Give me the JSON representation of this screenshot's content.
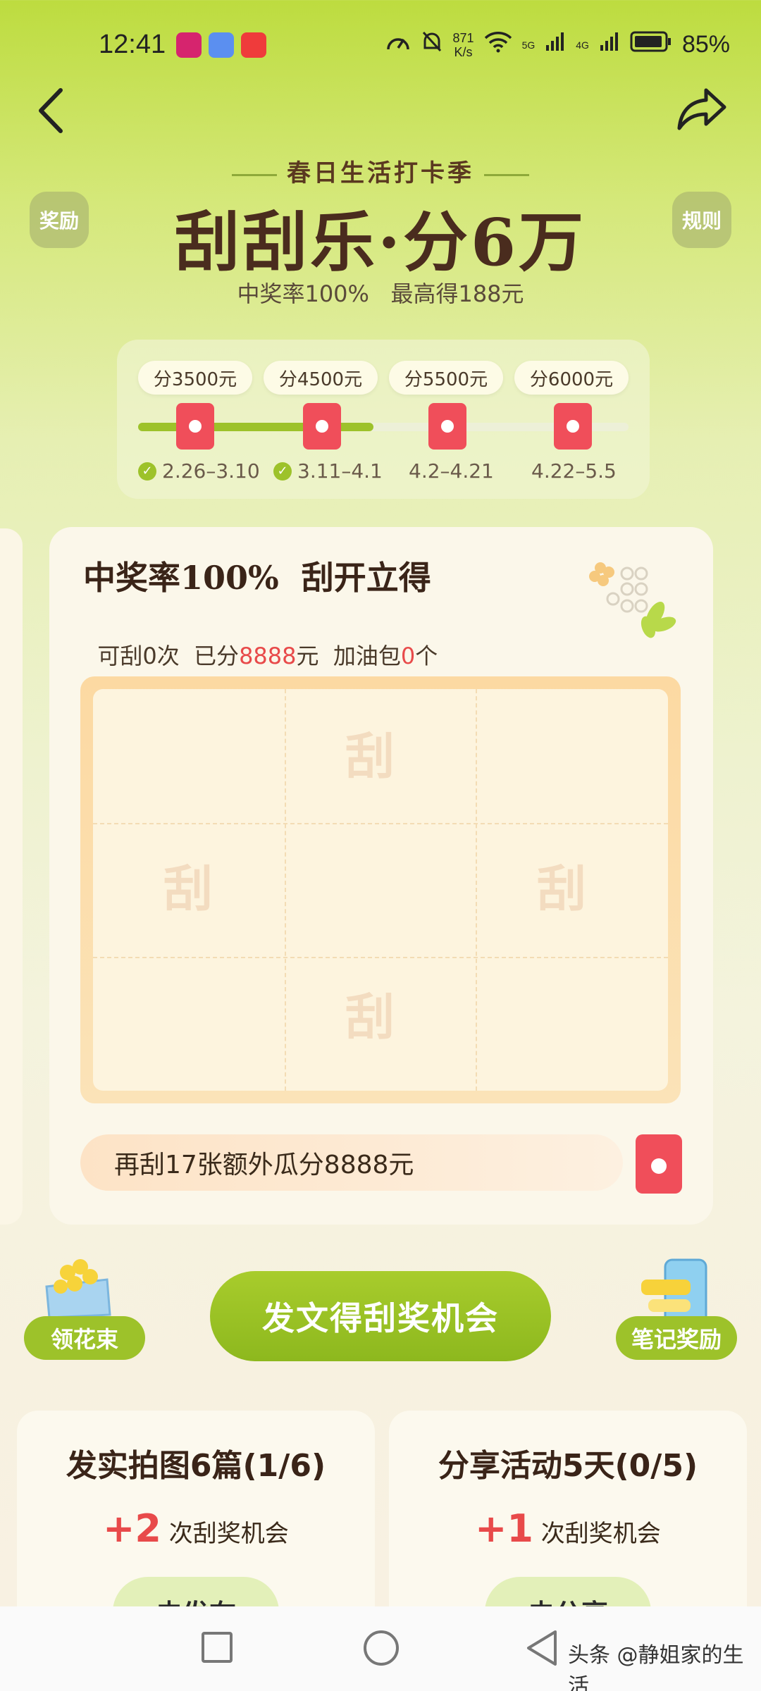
{
  "status_bar": {
    "time": "12:41",
    "net_speed_value": "871",
    "net_speed_unit": "K/s",
    "signal_1_label": "5G",
    "signal_2_label": "4G",
    "battery": "85%"
  },
  "header": {
    "season": "春日生活打卡季",
    "title": "刮刮乐·分6万",
    "subtitle": "中奖率100%   最高得188元",
    "rewards_label": "奖励",
    "rules_label": "规则"
  },
  "progress": {
    "stages": [
      {
        "amount": "分3500元",
        "dates": "2.26–3.10",
        "done": true
      },
      {
        "amount": "分4500元",
        "dates": "3.11–4.1",
        "done": true
      },
      {
        "amount": "分5500元",
        "dates": "4.2–4.21",
        "done": false
      },
      {
        "amount": "分6000元",
        "dates": "4.22–5.5",
        "done": false
      }
    ],
    "check_glyph": "✓",
    "completed_fraction": 0.48
  },
  "card": {
    "title": "中奖率100%  刮开立得",
    "stats_a": "可刮0次  已分",
    "stats_amount": "8888",
    "stats_b": "元  加油包",
    "stats_count": "0",
    "stats_c": "个",
    "scratch_char": "刮",
    "banner": "再刮17张额外瓜分8888元"
  },
  "actions": {
    "main_button": "发文得刮奖机会",
    "flowers_button": "领花束",
    "notes_button": "笔记奖励"
  },
  "tasks": [
    {
      "title": "发实拍图6篇(1/6)",
      "plus": "+2",
      "reward": " 次刮奖机会",
      "button": "去发布"
    },
    {
      "title": "分享活动5天(0/5)",
      "plus": "+1",
      "reward": " 次刮奖机会",
      "button": "去分享"
    }
  ],
  "watermark": "头条 @静姐家的生活",
  "colors": {
    "accent_green": "#9dc22a",
    "red_envelope": "#f04e5a",
    "highlight_red": "#e84a4a"
  }
}
